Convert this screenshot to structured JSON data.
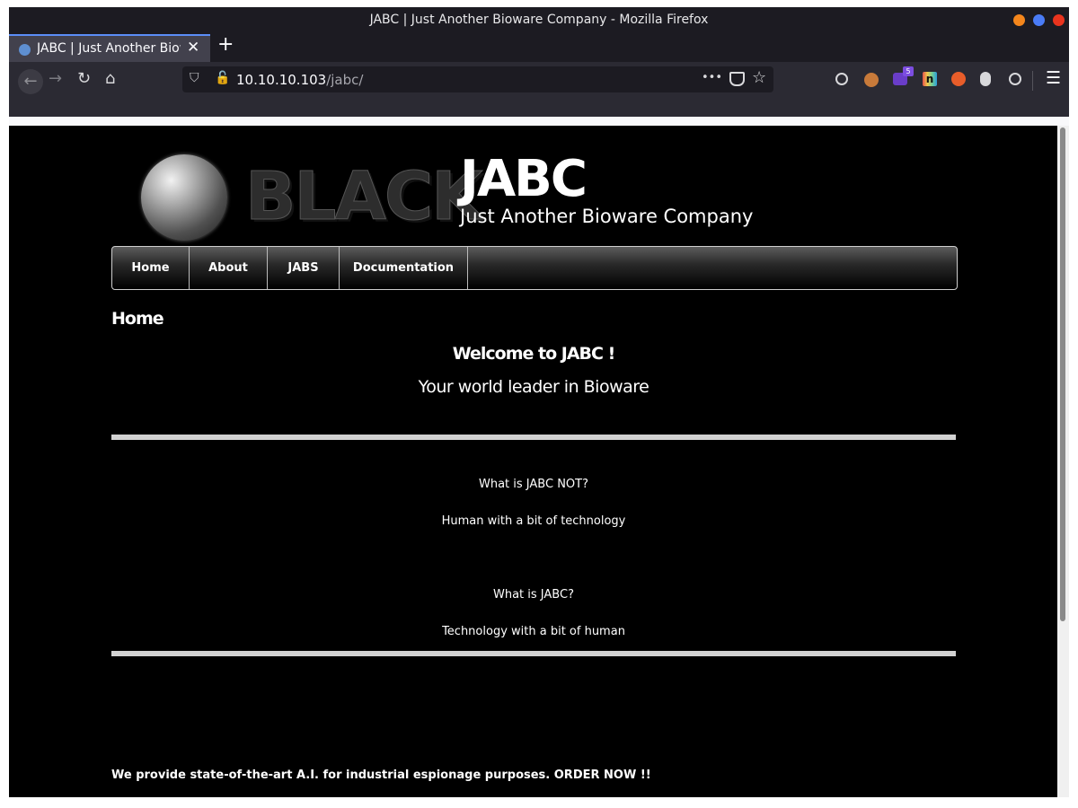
{
  "browser": {
    "window_title": "JABC | Just Another Bioware Company - Mozilla Firefox",
    "tab_title": "JABC | Just Another Bioware Company",
    "url_host": "10.10.10.103",
    "url_path": "/jabc/",
    "page_actions_glyph": "•••",
    "extension_badge": "5",
    "extension_letter": "n",
    "controls": {
      "close": "#e9341e",
      "maximize": "#4a7cf7",
      "minimize": "#f4861c"
    }
  },
  "site": {
    "logo_text": "BLACK",
    "name": "JABC",
    "slogan": "Just Another Bioware Company",
    "menu": [
      "Home",
      "About",
      "JABS",
      "Documentation"
    ],
    "page_title": "Home",
    "welcome": "Welcome to JABC !",
    "tagline": "Your world leader in Bioware",
    "q1": "What is JABC NOT?",
    "a1": "Human with a bit of technology",
    "q2": "What is JABC?",
    "a2": "Technology with a bit of human",
    "footer": "We provide state-of-the-art A.I. for industrial espionage purposes. ORDER  NOW !!"
  }
}
